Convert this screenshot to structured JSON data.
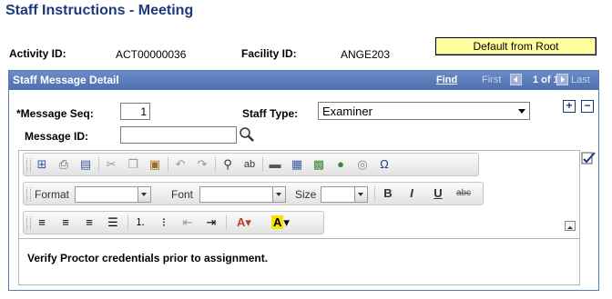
{
  "page": {
    "title": "Staff Instructions - Meeting"
  },
  "header": {
    "activity_label": "Activity ID:",
    "activity_value": "ACT00000036",
    "facility_label": "Facility ID:",
    "facility_value": "ANGE203",
    "default_button": "Default from Root"
  },
  "panel": {
    "title": "Staff Message Detail",
    "find": "Find",
    "first": "First",
    "count": "1 of 1",
    "last": "Last"
  },
  "form": {
    "seq_label": "*Message Seq:",
    "seq_value": "1",
    "staff_type_label": "Staff Type:",
    "staff_type_value": "Examiner",
    "message_id_label": "Message ID:",
    "message_id_value": "",
    "add_symbol": "+",
    "remove_symbol": "−"
  },
  "editor": {
    "format_label": "Format",
    "font_label": "Font",
    "size_label": "Size",
    "bold": "B",
    "italic": "I",
    "underline": "U",
    "strike": "abc",
    "content": "Verify Proctor credentials prior to assignment."
  },
  "colors": {
    "accent": "#1d3a7a",
    "panel_header": "#5a7bb5",
    "button": "#ffffa0"
  }
}
